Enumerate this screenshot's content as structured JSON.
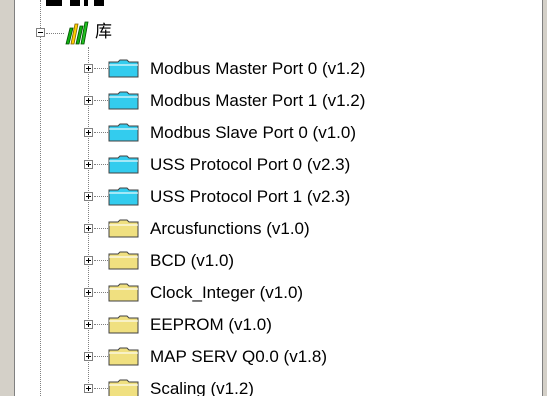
{
  "tree": {
    "root": {
      "label": "库",
      "icon": "library-icon",
      "expanded": true
    },
    "children": [
      {
        "label": "Modbus Master Port 0 (v1.2)",
        "icon": "folder-icon",
        "folder_color": "#33ccee"
      },
      {
        "label": "Modbus Master Port 1 (v1.2)",
        "icon": "folder-icon",
        "folder_color": "#33ccee"
      },
      {
        "label": "Modbus Slave Port 0 (v1.0)",
        "icon": "folder-icon",
        "folder_color": "#33ccee"
      },
      {
        "label": "USS Protocol Port 0 (v2.3)",
        "icon": "folder-icon",
        "folder_color": "#33ccee"
      },
      {
        "label": "USS Protocol Port 1 (v2.3)",
        "icon": "folder-icon",
        "folder_color": "#33ccee"
      },
      {
        "label": "Arcusfunctions (v1.0)",
        "icon": "folder-icon",
        "folder_color": "#f0e080"
      },
      {
        "label": "BCD (v1.0)",
        "icon": "folder-icon",
        "folder_color": "#f0e080"
      },
      {
        "label": "Clock_Integer (v1.0)",
        "icon": "folder-icon",
        "folder_color": "#f0e080"
      },
      {
        "label": "EEPROM (v1.0)",
        "icon": "folder-icon",
        "folder_color": "#f0e080"
      },
      {
        "label": "MAP SERV Q0.0 (v1.8)",
        "icon": "folder-icon",
        "folder_color": "#f0e080"
      },
      {
        "label": "Scaling (v1.2)",
        "icon": "folder-icon",
        "folder_color": "#f0e080"
      }
    ]
  },
  "colors": {
    "panel_gray": "#d4d0c8",
    "tree_line": "#808080"
  }
}
